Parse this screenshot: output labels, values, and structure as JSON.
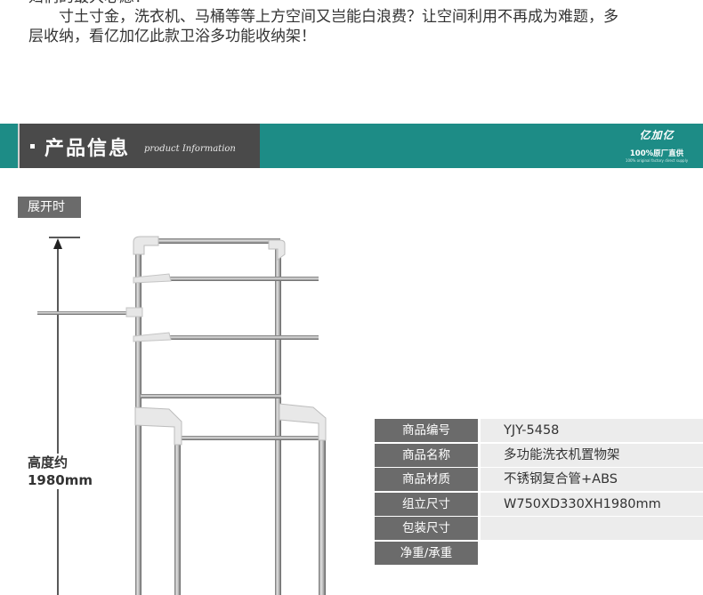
{
  "intro": {
    "line1": "妇们的最大心愿！",
    "line2": "　　寸土寸金，洗衣机、马桶等等上方空间又岂能白浪费？让空间利用不再成为难题，多",
    "line3": "层收纳，看亿加亿此款卫浴多功能收纳架！"
  },
  "banner": {
    "title": "产品信息",
    "subtitle": "product Information",
    "brand_mark": "亿加亿",
    "brand_line": "100%原厂直供",
    "brand_tiny": "100% original factory direct supply",
    "color_teal": "#1d8c86",
    "color_dark": "#4a4a4a"
  },
  "tag": {
    "label": "展开时"
  },
  "dimension": {
    "label_line1": "高度约",
    "label_line2": "1980mm"
  },
  "specs": [
    {
      "key": "商品编号",
      "value": "YJY-5458"
    },
    {
      "key": "商品名称",
      "value": "多功能洗衣机置物架"
    },
    {
      "key": "商品材质",
      "value": "不锈钢复合管+ABS"
    },
    {
      "key": "组立尺寸",
      "value": "W750XD330XH1980mm"
    },
    {
      "key": "包装尺寸",
      "value": ""
    },
    {
      "key": "净重/承重",
      "value": ""
    }
  ]
}
